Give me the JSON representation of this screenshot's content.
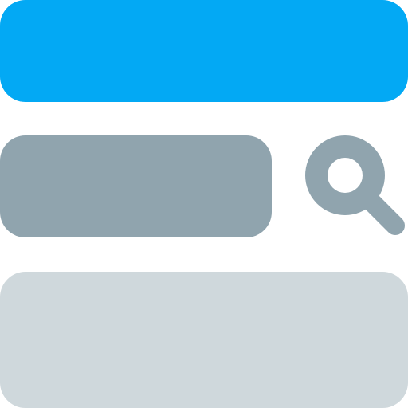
{
  "colors": {
    "header_bar": "#03A9F4",
    "search_field": "#90A4AE",
    "search_icon": "#90A4AE",
    "content_block": "#CFD8DC",
    "background": "#FFFFFF"
  },
  "icons": {
    "search": "search-icon"
  }
}
